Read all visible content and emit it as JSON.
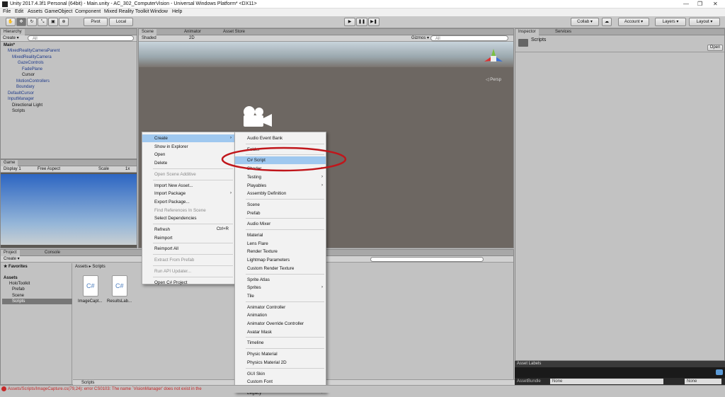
{
  "window": {
    "title": "Unity 2017.4.3f1 Personal (64bit) - Main.unity - AC_302_ComputerVision - Universal Windows Platform* <DX11>",
    "min": "—",
    "max": "❐",
    "close": "✕"
  },
  "menu": [
    "File",
    "Edit",
    "Assets",
    "GameObject",
    "Component",
    "Mixed Reality Toolkit",
    "Window",
    "Help"
  ],
  "toolbar": {
    "pivot": "Pivot",
    "local": "Local",
    "collab": "Collab ▾",
    "account": "Account ▾",
    "layers": "Layers ▾",
    "layout": "Layout ▾",
    "play": "▶",
    "pause": "❚❚",
    "step": "▶❚"
  },
  "hierarchy": {
    "tab": "Hierarchy",
    "create": "Create ▾",
    "search": "All",
    "items": [
      "Main*",
      "MixedRealityCameraParent",
      "MixedRealityCamera",
      "GazeControls",
      "FadePlane",
      "Cursor",
      "MotionControllers",
      "Boundary",
      "DefaultCursor",
      "InputManager",
      "Directional Light",
      "Scripts"
    ]
  },
  "scene": {
    "tabs": [
      "Scene",
      "Animator",
      "Asset Store"
    ],
    "shaded": "Shaded",
    "twod": "2D",
    "gizmos": "Gizmos ▾",
    "search": "All",
    "persp": "◁ Persp"
  },
  "game": {
    "tab": "Game",
    "display": "Display 1",
    "aspect": "Free Aspect",
    "scale": "Scale",
    "scale_val": "1x"
  },
  "inspector": {
    "tabs": [
      "Inspector",
      "Services"
    ],
    "name": "Scripts",
    "open": "Open",
    "asset_labels": "Asset Labels",
    "asset_bundle": "AssetBundle",
    "none1": "None",
    "none2": "None"
  },
  "project": {
    "tabs": [
      "Project",
      "Console"
    ],
    "create": "Create ▾",
    "favorites": "Favorites",
    "assets": "Assets",
    "tree": [
      "HoloToolkit",
      "Prefab",
      "Scene",
      "Scripts"
    ],
    "breadcrumb": "Assets ▸ Scripts",
    "files": [
      "ImageCapt...",
      "ResultsLab..."
    ],
    "footer": "Scripts"
  },
  "context_menu": [
    {
      "label": "Create",
      "arrow": true,
      "state": "hl"
    },
    {
      "label": "Show in Explorer"
    },
    {
      "label": "Open"
    },
    {
      "label": "Delete"
    },
    {
      "sep": true
    },
    {
      "label": "Open Scene Additive",
      "state": "dis"
    },
    {
      "sep": true
    },
    {
      "label": "Import New Asset..."
    },
    {
      "label": "Import Package",
      "arrow": true
    },
    {
      "label": "Export Package..."
    },
    {
      "label": "Find References In Scene",
      "state": "dis"
    },
    {
      "label": "Select Dependencies"
    },
    {
      "sep": true
    },
    {
      "label": "Refresh",
      "shortcut": "Ctrl+R"
    },
    {
      "label": "Reimport"
    },
    {
      "sep": true
    },
    {
      "label": "Reimport All"
    },
    {
      "sep": true
    },
    {
      "label": "Extract From Prefab",
      "state": "dis"
    },
    {
      "sep": true
    },
    {
      "label": "Run API Updater...",
      "state": "dis"
    },
    {
      "sep": true
    },
    {
      "label": "Open C# Project"
    }
  ],
  "submenu": [
    {
      "label": "Audio Event Bank"
    },
    {
      "sep": true
    },
    {
      "label": "Folder"
    },
    {
      "sep": true
    },
    {
      "label": "C# Script",
      "state": "hl"
    },
    {
      "label": "Shader",
      "arrow": true
    },
    {
      "label": "Testing",
      "arrow": true
    },
    {
      "label": "Playables",
      "arrow": true
    },
    {
      "label": "Assembly Definition"
    },
    {
      "sep": true
    },
    {
      "label": "Scene"
    },
    {
      "label": "Prefab"
    },
    {
      "sep": true
    },
    {
      "label": "Audio Mixer"
    },
    {
      "sep": true
    },
    {
      "label": "Material"
    },
    {
      "label": "Lens Flare"
    },
    {
      "label": "Render Texture"
    },
    {
      "label": "Lightmap Parameters"
    },
    {
      "label": "Custom Render Texture"
    },
    {
      "sep": true
    },
    {
      "label": "Sprite Atlas"
    },
    {
      "label": "Sprites",
      "arrow": true
    },
    {
      "label": "Tile"
    },
    {
      "sep": true
    },
    {
      "label": "Animator Controller"
    },
    {
      "label": "Animation"
    },
    {
      "label": "Animator Override Controller"
    },
    {
      "label": "Avatar Mask"
    },
    {
      "sep": true
    },
    {
      "label": "Timeline"
    },
    {
      "sep": true
    },
    {
      "label": "Physic Material"
    },
    {
      "label": "Physics Material 2D"
    },
    {
      "sep": true
    },
    {
      "label": "GUI Skin"
    },
    {
      "label": "Custom Font"
    },
    {
      "sep": true
    },
    {
      "label": "Legacy",
      "arrow": true
    }
  ],
  "status": {
    "text": "Assets/Scripts/ImageCapture.cs(79,24): error CS0103: The name `VisionManager' does not exist in the"
  },
  "colors": {
    "highlight": "#9fc8ef",
    "annotation": "#c0161b",
    "error": "#c62828"
  }
}
